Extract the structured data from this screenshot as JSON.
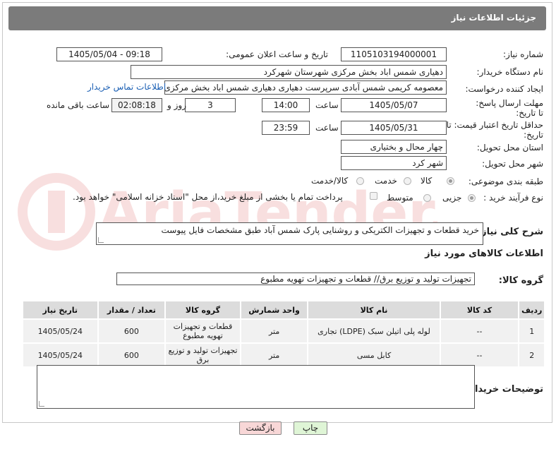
{
  "header": {
    "title": "جزئیات اطلاعات نیاز"
  },
  "fields": {
    "need_number_label": "شماره نیاز:",
    "need_number": "1105103194000001",
    "announce_label": "تاریخ و ساعت اعلان عمومی:",
    "announce_value": "1405/05/04 - 09:18",
    "buyer_org_label": "نام دستگاه خریدار:",
    "buyer_org": "دهیاری شمس اباد بخش مرکزی شهرستان شهرکرد",
    "creator_label": "ایجاد کننده درخواست:",
    "creator": "معصومه کریمی شمس آبادی سرپرست دهیاری دهیاری شمس اباد بخش مرکزی",
    "contact_link": "اطلاعات تماس خریدار",
    "deadline_label": "مهلت ارسال پاسخ: تا تاریخ:",
    "deadline_date": "1405/05/07",
    "time_label": "ساعت",
    "deadline_time": "14:00",
    "days_value": "3",
    "days_label": "روز و",
    "remaining_time": "02:08:18",
    "remaining_label": "ساعت باقی مانده",
    "price_validity_label": "حداقل تاریخ اعتبار قیمت: تا تاریخ:",
    "price_validity_date": "1405/05/31",
    "price_validity_time": "23:59",
    "province_label": "استان محل تحویل:",
    "province": "چهار محال و بختیاری",
    "city_label": "شهر محل تحویل:",
    "city": "شهر کرد",
    "category_label": "طبقه بندی موضوعی:",
    "category_options": [
      "کالا",
      "خدمت",
      "کالا/خدمت"
    ],
    "purchase_type_label": "نوع فرآیند خرید :",
    "purchase_options": [
      "جزیی",
      "متوسط"
    ],
    "payment_note": "پرداخت تمام یا بخشی از مبلغ خرید،از محل \"اسناد خزانه اسلامی\" خواهد بود.",
    "description_label": "شرح کلی نیاز:",
    "description": "خرید قطعات و تجهیزات الکتریکی و روشنایی پارک شمس آباد طبق مشخصات فایل پیوست",
    "goods_info_label": "اطلاعات کالاهای مورد نیاز",
    "goods_group_label": "گروه کالا:",
    "goods_group": "تجهیزات تولید و توزیع برق//  قطعات و تجهیزات تهویه مطبوع",
    "buyer_notes_label": "توضیحات خریدار:",
    "buyer_notes": ""
  },
  "table": {
    "headers": [
      "ردیف",
      "کد کالا",
      "نام کالا",
      "واحد شمارش",
      "گروه کالا",
      "تعداد / مقدار",
      "تاریخ نیاز"
    ],
    "rows": [
      [
        "1",
        "--",
        "لوله پلی اتیلن سبک (LDPE) تجاری",
        "متر",
        "قطعات و تجهیزات تهویه مطبوع",
        "600",
        "1405/05/24"
      ],
      [
        "2",
        "--",
        "کابل مسی",
        "متر",
        "تجهیزات تولید و توزیع برق",
        "600",
        "1405/05/24"
      ]
    ]
  },
  "buttons": {
    "print": "چاپ",
    "back": "بازگشت"
  },
  "colors": {
    "header": "#7b7b7b",
    "print_btn": "#dff5d6",
    "back_btn": "#f8d7d7"
  }
}
